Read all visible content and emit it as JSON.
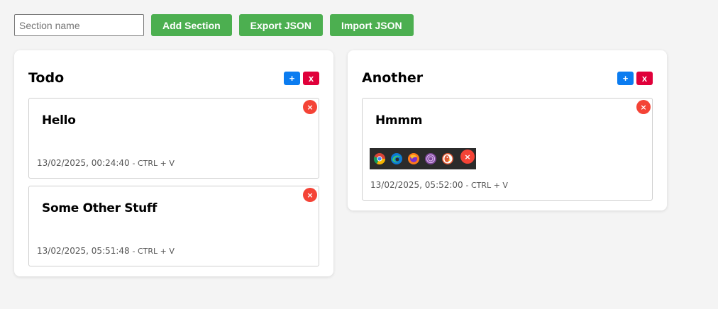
{
  "toolbar": {
    "section_placeholder": "Section name",
    "add_section_label": "Add Section",
    "export_label": "Export JSON",
    "import_label": "Import JSON"
  },
  "sections": [
    {
      "title": "Todo",
      "add_label": "+",
      "delete_label": "x",
      "cards": [
        {
          "title": "Hello",
          "timestamp": "13/02/2025, 00:24:40",
          "hint": "- CTRL + V",
          "close_label": "×"
        },
        {
          "title": "Some Other Stuff",
          "timestamp": "13/02/2025, 05:51:48",
          "hint": "- CTRL + V",
          "close_label": "×"
        }
      ]
    },
    {
      "title": "Another",
      "add_label": "+",
      "delete_label": "x",
      "cards": [
        {
          "title": "Hmmm",
          "timestamp": "13/02/2025, 05:52:00",
          "hint": "- CTRL + V",
          "close_label": "×",
          "image": {
            "icons": [
              "chrome-icon",
              "edge-icon",
              "firefox-icon",
              "tor-browser-icon",
              "duckduckgo-icon"
            ],
            "close_label": "×"
          }
        }
      ]
    }
  ],
  "colors": {
    "green": "#4caf50",
    "blue": "#0b7cf0",
    "red_delete": "#e0003a",
    "close_red": "#f44336"
  }
}
